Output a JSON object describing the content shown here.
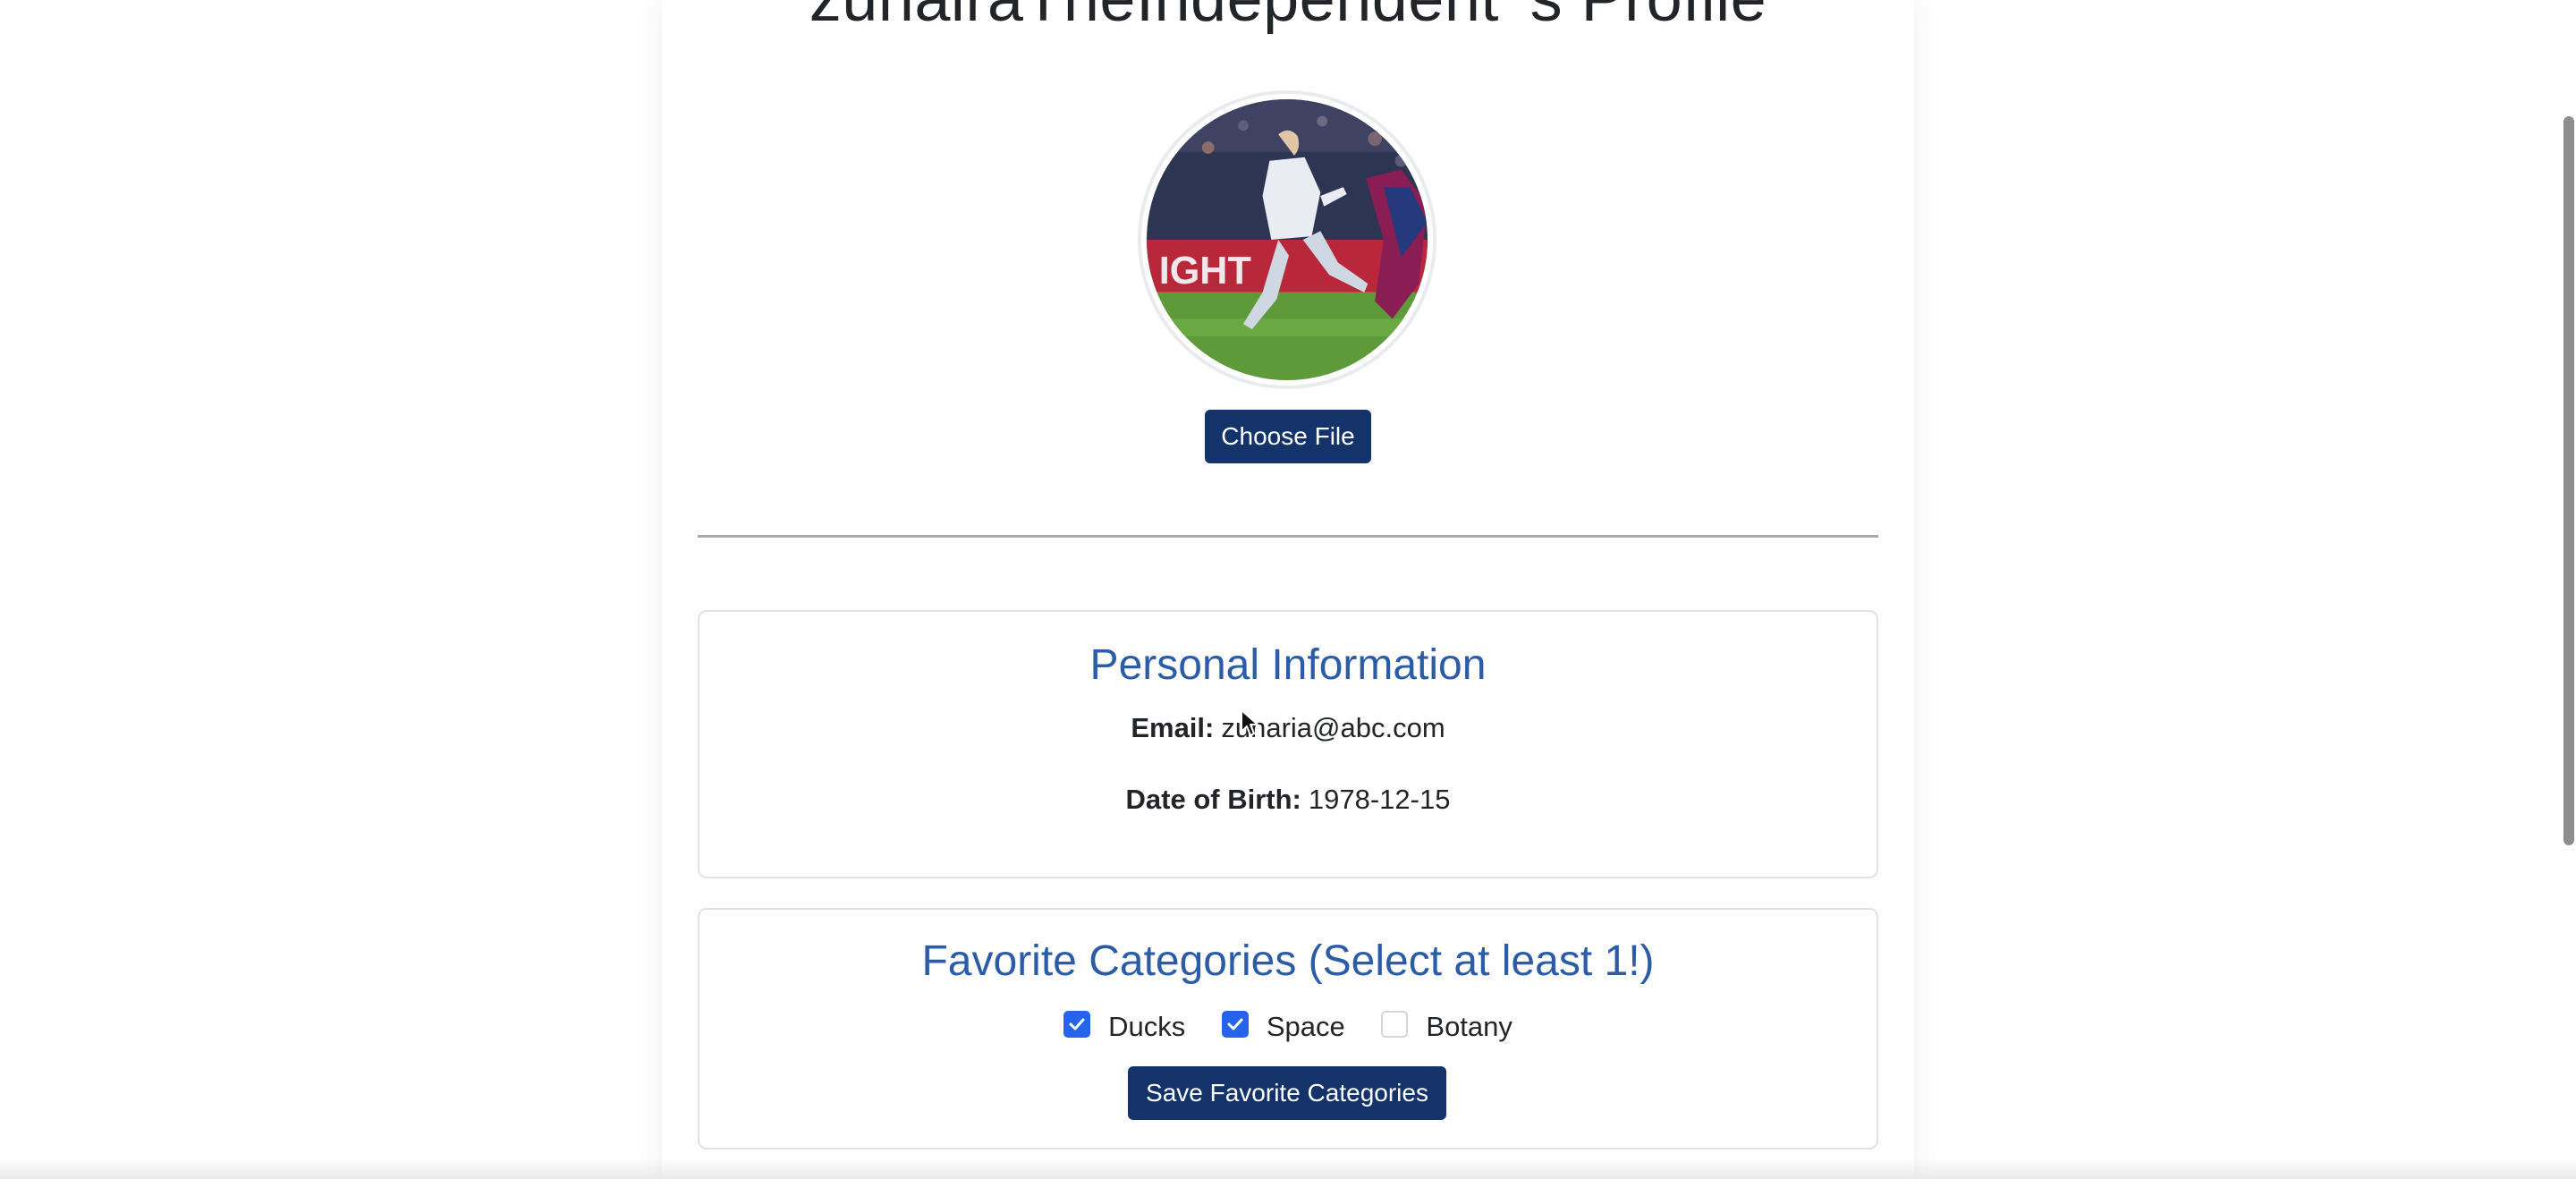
{
  "profile": {
    "title": "zunairaTheIndependent 's Profile"
  },
  "avatar": {
    "alt": "Profile picture"
  },
  "upload": {
    "choose_file_label": "Choose File"
  },
  "personal_info": {
    "heading": "Personal Information",
    "email_label": "Email:",
    "email_value": "zunaria@abc.com",
    "dob_label": "Date of Birth:",
    "dob_value": "1978-12-15"
  },
  "favorites": {
    "heading": "Favorite Categories (Select at least 1!)",
    "options": [
      {
        "label": "Ducks",
        "checked": true
      },
      {
        "label": "Space",
        "checked": true
      },
      {
        "label": "Botany",
        "checked": false
      }
    ],
    "save_label": "Save Favorite Categories"
  },
  "colors": {
    "primary_button": "#14336b",
    "heading_blue": "#2b5ca8",
    "checkbox_checked": "#2563eb"
  },
  "icons": {
    "checkbox_check": "checkmark-icon",
    "cursor": "mouse-pointer-icon"
  }
}
